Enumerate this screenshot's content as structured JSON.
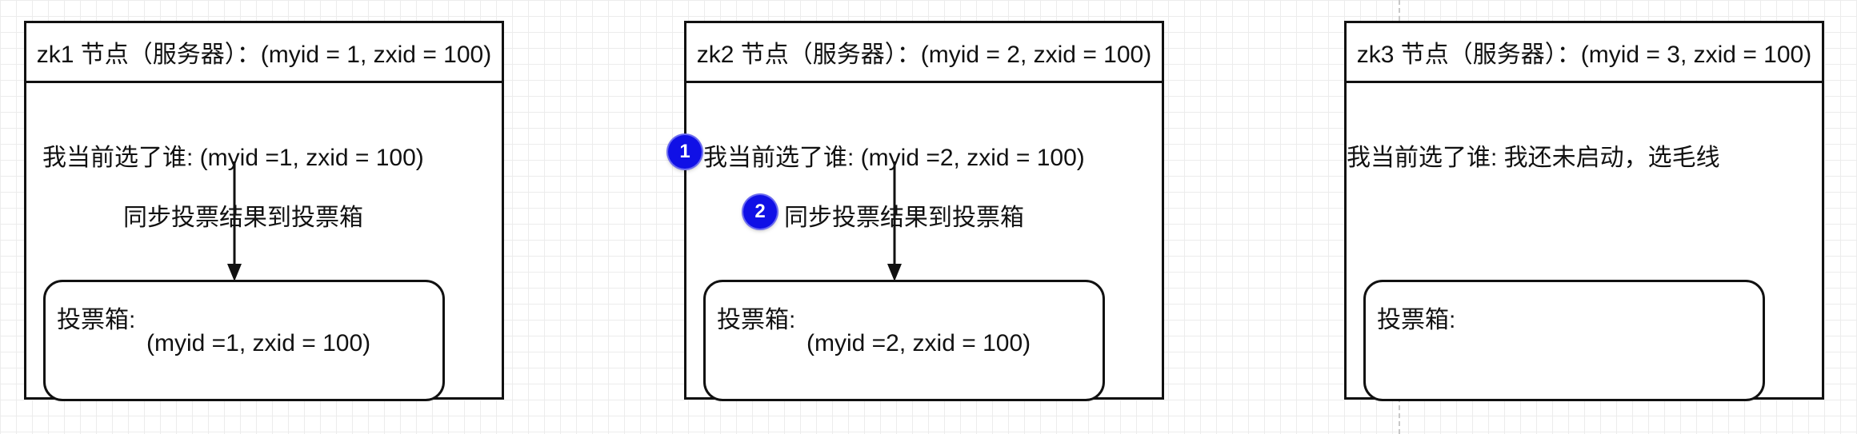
{
  "nodes": [
    {
      "header": "zk1 节点（服务器）：(myid = 1, zxid = 100)",
      "current_vote": "我当前选了谁: (myid =1, zxid = 100)",
      "sync_label": "同步投票结果到投票箱",
      "ballot_box_title": "投票箱:",
      "ballot_box_value": "(myid =1, zxid = 100)"
    },
    {
      "header": "zk2 节点（服务器）：(myid = 2, zxid = 100)",
      "current_vote": "我当前选了谁: (myid =2, zxid = 100)",
      "sync_label": "同步投票结果到投票箱",
      "ballot_box_title": "投票箱:",
      "ballot_box_value": "(myid =2, zxid = 100)"
    },
    {
      "header": "zk3 节点（服务器）：(myid = 3, zxid = 100)",
      "current_vote": "我当前选了谁: 我还未启动，选毛线",
      "ballot_box_title": "投票箱:"
    }
  ],
  "badges": [
    "1",
    "2"
  ],
  "colors": {
    "badge": "#1010e6",
    "stroke": "#111111"
  }
}
